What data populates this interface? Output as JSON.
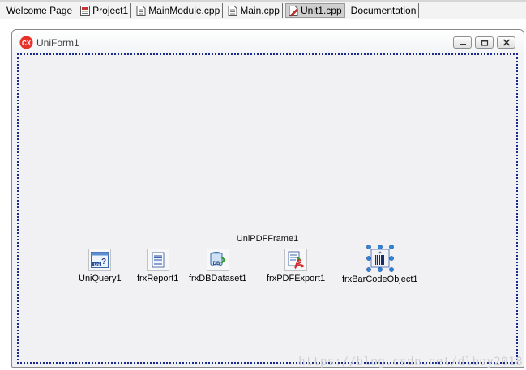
{
  "tabs": [
    {
      "label": "Welcome Page",
      "icon": "none",
      "active": false
    },
    {
      "label": "Project1",
      "icon": "project-icon",
      "active": false
    },
    {
      "label": "MainModule.cpp",
      "icon": "cpp-file-icon",
      "active": false
    },
    {
      "label": "Main.cpp",
      "icon": "cpp-file-icon",
      "active": false
    },
    {
      "label": "Unit1.cpp",
      "icon": "edit-file-icon",
      "active": true
    },
    {
      "label": "Documentation",
      "icon": "none",
      "active": false
    }
  ],
  "form": {
    "title": "UniForm1",
    "title_icon": "cx-logo-icon",
    "frame_label": "UniPDFFrame1"
  },
  "components": [
    {
      "label": "UniQuery1",
      "icon": "query-icon"
    },
    {
      "label": "frxReport1",
      "icon": "report-icon"
    },
    {
      "label": "frxDBDataset1",
      "icon": "db-dataset-icon"
    },
    {
      "label": "frxPDFExport1",
      "icon": "pdf-export-icon"
    },
    {
      "label": "frxBarCodeObject1",
      "icon": "barcode-object-icon"
    }
  ],
  "watermark": "https://blog.csdn.net/dlboy2018",
  "colors": {
    "selection_dots": "#1a2a8a",
    "cx_logo": "#e8312a",
    "pdf_red": "#d42a2a"
  }
}
